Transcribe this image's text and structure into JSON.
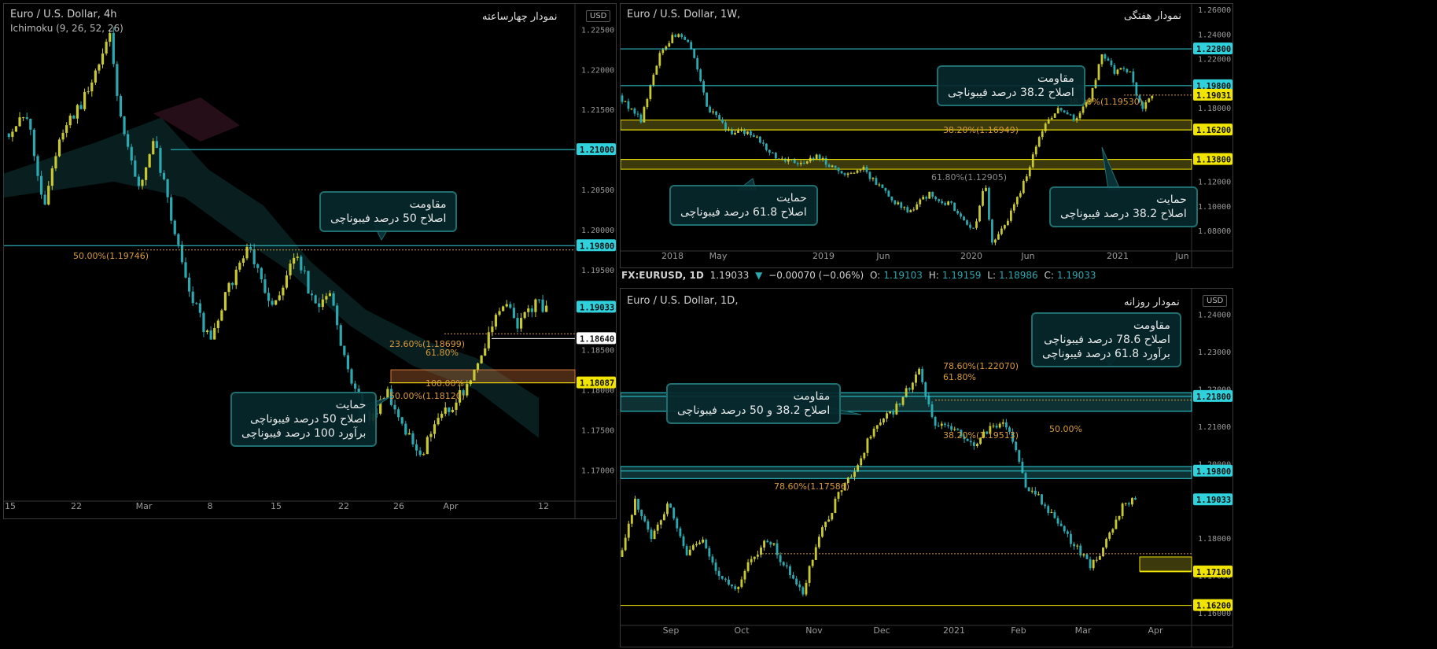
{
  "chart_data": [
    {
      "id": "h4",
      "type": "candlestick",
      "title": "Euro / U.S. Dollar, 4h",
      "indicator": "Ichimoku (9, 26, 52, 26)",
      "name_fa": "نمودار چهارساعته",
      "currency": "USD",
      "y_ticks": [
        "1.22500",
        "1.22000",
        "1.21500",
        "1.21000",
        "1.20500",
        "1.20000",
        "1.19500",
        "1.19000",
        "1.18500",
        "1.18000",
        "1.17500",
        "1.17000"
      ],
      "y_range": [
        1.1665,
        1.227
      ],
      "x_ticks": [
        "15",
        "22",
        "Mar",
        "8",
        "15",
        "22",
        "26",
        "Apr",
        "12"
      ],
      "price_tags": [
        {
          "value": "1.21000",
          "style": "cyan"
        },
        {
          "value": "1.19800",
          "style": "cyan"
        },
        {
          "value": "1.19033",
          "style": "cyan"
        },
        {
          "value": "1.18640",
          "style": "white"
        },
        {
          "value": "1.18087",
          "style": "yellow"
        }
      ],
      "fib_labels": [
        "50.00%(1.19746)",
        "23.60%(1.18699)",
        "61.80%",
        "100.00%",
        "50.00%(1.18120)"
      ],
      "callouts": [
        {
          "lines": [
            "مقاومت",
            "اصلاح 50 درصد فیبوناچی"
          ]
        },
        {
          "lines": [
            "حمایت",
            "اصلاح 50 درصد فیبوناچی",
            "برآورد 100 درصد فیبوناچی"
          ]
        }
      ],
      "path": [
        [
          0,
          1.212
        ],
        [
          0.04,
          1.214
        ],
        [
          0.07,
          1.203
        ],
        [
          0.1,
          1.212
        ],
        [
          0.14,
          1.216
        ],
        [
          0.19,
          1.224
        ],
        [
          0.21,
          1.213
        ],
        [
          0.24,
          1.205
        ],
        [
          0.27,
          1.211
        ],
        [
          0.3,
          1.202
        ],
        [
          0.33,
          1.193
        ],
        [
          0.37,
          1.186
        ],
        [
          0.4,
          1.192
        ],
        [
          0.44,
          1.198
        ],
        [
          0.48,
          1.19
        ],
        [
          0.53,
          1.197
        ],
        [
          0.56,
          1.19
        ],
        [
          0.59,
          1.192
        ],
        [
          0.62,
          1.182
        ],
        [
          0.66,
          1.176
        ],
        [
          0.69,
          1.18
        ],
        [
          0.72,
          1.176
        ],
        [
          0.75,
          1.171
        ],
        [
          0.78,
          1.176
        ],
        [
          0.81,
          1.178
        ],
        [
          0.84,
          1.181
        ],
        [
          0.87,
          1.186
        ],
        [
          0.9,
          1.191
        ],
        [
          0.93,
          1.188
        ],
        [
          0.96,
          1.191
        ],
        [
          0.98,
          1.19
        ]
      ]
    },
    {
      "id": "w1",
      "type": "candlestick",
      "title": "Euro / U.S. Dollar, 1W,",
      "name_fa": "نمودار هفتگی",
      "currency": "USD",
      "y_ticks": [
        "1.26000",
        "1.24000",
        "1.22000",
        "1.20000",
        "1.18000",
        "1.16000",
        "1.14000",
        "1.12000",
        "1.10000",
        "1.08000"
      ],
      "y_range": [
        1.066,
        1.262
      ],
      "x_ticks": [
        "2018",
        "May",
        "2019",
        "Jun",
        "2020",
        "Jun",
        "2021",
        "Jun"
      ],
      "price_tags": [
        {
          "value": "1.22800",
          "style": "cyan"
        },
        {
          "value": "1.19800",
          "style": "cyan"
        },
        {
          "value": "1.19031",
          "style": "yellow"
        },
        {
          "value": "1.16200",
          "style": "yellow"
        },
        {
          "value": "1.13800",
          "style": "yellow"
        }
      ],
      "fib_labels": [
        "38.20%(1.19530)",
        "38.20%(1.16949)",
        "61.80%(1.12905)"
      ],
      "callouts": [
        {
          "lines": [
            "مقاومت",
            "اصلاح 38.2 درصد فیبوناچی"
          ]
        },
        {
          "lines": [
            "حمایت",
            "اصلاح 61.8 درصد فیبوناچی"
          ]
        },
        {
          "lines": [
            "حمایت",
            "اصلاح 38.2 درصد فیبوناچی"
          ]
        }
      ],
      "path": [
        [
          0,
          1.19
        ],
        [
          0.04,
          1.17
        ],
        [
          0.07,
          1.22
        ],
        [
          0.1,
          1.24
        ],
        [
          0.13,
          1.23
        ],
        [
          0.16,
          1.18
        ],
        [
          0.2,
          1.16
        ],
        [
          0.24,
          1.16
        ],
        [
          0.28,
          1.14
        ],
        [
          0.32,
          1.135
        ],
        [
          0.36,
          1.14
        ],
        [
          0.4,
          1.125
        ],
        [
          0.44,
          1.13
        ],
        [
          0.48,
          1.11
        ],
        [
          0.52,
          1.095
        ],
        [
          0.56,
          1.11
        ],
        [
          0.6,
          1.1
        ],
        [
          0.64,
          1.08
        ],
        [
          0.66,
          1.12
        ],
        [
          0.67,
          1.07
        ],
        [
          0.7,
          1.09
        ],
        [
          0.73,
          1.12
        ],
        [
          0.76,
          1.16
        ],
        [
          0.79,
          1.18
        ],
        [
          0.82,
          1.17
        ],
        [
          0.85,
          1.19
        ],
        [
          0.87,
          1.225
        ],
        [
          0.89,
          1.21
        ],
        [
          0.92,
          1.21
        ],
        [
          0.94,
          1.18
        ],
        [
          0.96,
          1.19
        ]
      ]
    },
    {
      "id": "d1",
      "type": "candlestick",
      "title": "Euro / U.S. Dollar, 1D,",
      "name_fa": "نمودار روزانه",
      "currency": "USD",
      "y_ticks": [
        "1.24000",
        "1.23000",
        "1.22000",
        "1.21000",
        "1.20000",
        "1.19000",
        "1.18000",
        "1.17000",
        "1.16000"
      ],
      "y_range": [
        1.1575,
        1.246
      ],
      "x_ticks": [
        "Sep",
        "Oct",
        "Nov",
        "Dec",
        "2021",
        "Feb",
        "Mar",
        "Apr"
      ],
      "price_tags": [
        {
          "value": "1.21800",
          "style": "cyan"
        },
        {
          "value": "1.19800",
          "style": "cyan"
        },
        {
          "value": "1.19033",
          "style": "cyan"
        },
        {
          "value": "1.17100",
          "style": "yellow"
        },
        {
          "value": "1.16200",
          "style": "yellow"
        }
      ],
      "fib_labels": [
        "78.60%(1.22070)",
        "61.80%",
        "38.20%(1.19513)",
        "50.00%",
        "78.60%(1.17586)"
      ],
      "callouts": [
        {
          "lines": [
            "مقاومت",
            "اصلاح 78.6 درصد فیبوناچی",
            "برآورد 61.8 درصد فیبوناچی"
          ]
        },
        {
          "lines": [
            "مقاومت",
            "اصلاح 38.2 و 50 درصد فیبوناچی"
          ]
        }
      ],
      "path": [
        [
          0,
          1.175
        ],
        [
          0.03,
          1.19
        ],
        [
          0.06,
          1.18
        ],
        [
          0.09,
          1.19
        ],
        [
          0.12,
          1.175
        ],
        [
          0.15,
          1.18
        ],
        [
          0.18,
          1.17
        ],
        [
          0.21,
          1.166
        ],
        [
          0.24,
          1.175
        ],
        [
          0.27,
          1.18
        ],
        [
          0.3,
          1.172
        ],
        [
          0.33,
          1.165
        ],
        [
          0.36,
          1.18
        ],
        [
          0.39,
          1.19
        ],
        [
          0.43,
          1.2
        ],
        [
          0.46,
          1.21
        ],
        [
          0.5,
          1.215
        ],
        [
          0.54,
          1.225
        ],
        [
          0.57,
          1.21
        ],
        [
          0.6,
          1.21
        ],
        [
          0.64,
          1.205
        ],
        [
          0.67,
          1.21
        ],
        [
          0.7,
          1.21
        ],
        [
          0.73,
          1.195
        ],
        [
          0.76,
          1.19
        ],
        [
          0.79,
          1.185
        ],
        [
          0.82,
          1.178
        ],
        [
          0.85,
          1.172
        ],
        [
          0.88,
          1.18
        ],
        [
          0.91,
          1.19
        ],
        [
          0.93,
          1.19
        ]
      ]
    }
  ],
  "strip": {
    "symbol": "FX:EURUSD, 1D",
    "price": "1.19033",
    "change": "−0.00070 (−0.06%)",
    "o_label": "O:",
    "o_value": "1.19103",
    "h_label": "H:",
    "h_value": "1.19159",
    "l_label": "L:",
    "l_value": "1.18986",
    "c_label": "C:",
    "c_value": "1.19033"
  },
  "colors": {
    "up": "#c8c832",
    "down": "#2ba8b0",
    "cyan_line": "#2fd2dc",
    "yellow_line": "#f0e400",
    "fib": "#d89a3a"
  }
}
